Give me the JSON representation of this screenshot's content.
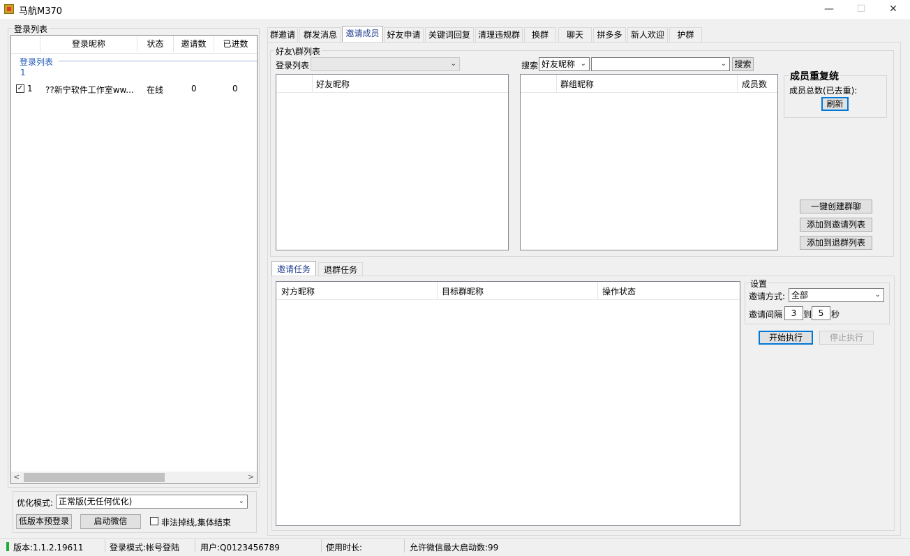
{
  "window": {
    "title": "马航M370"
  },
  "left": {
    "group_title": "登录列表",
    "columns": [
      "登录昵称",
      "状态",
      "邀请数",
      "已进数"
    ],
    "group_label": "登录列表",
    "group_count": "1",
    "rows": [
      {
        "index": "1",
        "checked": true,
        "nickname": "??新宁软件工作室ww...",
        "status": "在线",
        "invites": "0",
        "joined": "0"
      }
    ],
    "opt_label": "优化模式:",
    "opt_value": "正常版(无任何优化)",
    "btn_lowver": "低版本预登录",
    "btn_launch": "启动微信",
    "chk_offline": "非法掉线,集体结束"
  },
  "tabs": [
    "群邀请",
    "群发消息",
    "邀请成员",
    "好友申请",
    "关键词回复",
    "清理违规群",
    "换群",
    "聊天",
    "拼多多",
    "新人欢迎",
    "护群"
  ],
  "active_tab": "邀请成员",
  "friends": {
    "group_title": "好友\\群列表",
    "login_label": "登录列表",
    "search_label": "搜索",
    "search_type": "好友昵称",
    "search_btn": "搜索",
    "friend_col": "好友昵称",
    "group_col": "群组昵称",
    "member_col": "成员数"
  },
  "dedup": {
    "title": "成员重复统",
    "total_label": "成员总数(已去重):",
    "refresh": "刷新"
  },
  "actions": {
    "create_group": "一键创建群聊",
    "add_invite": "添加到邀请列表",
    "add_quit": "添加到退群列表"
  },
  "tasks": {
    "tab_invite": "邀请任务",
    "tab_quit": "退群任务",
    "columns": [
      "对方昵称",
      "目标群昵称",
      "操作状态"
    ]
  },
  "settings": {
    "group_title": "设置",
    "mode_label": "邀请方式:",
    "mode_value": "全部",
    "interval_label": "邀请间隔",
    "interval_from": "3",
    "interval_to_label": "到",
    "interval_to": "5",
    "sec_label": "秒",
    "start": "开始执行",
    "stop": "停止执行"
  },
  "status": {
    "version": "版本:1.1.2.19611",
    "login_mode": "登录模式:帐号登陆",
    "user": "用户:Q0123456789",
    "usage": "使用时长:",
    "max": "允许微信最大启动数:99"
  },
  "icons": {
    "checkbox_checked": "✓",
    "dropdown": "⌄",
    "minimize": "—",
    "maximize": "☐",
    "close": "✕"
  }
}
